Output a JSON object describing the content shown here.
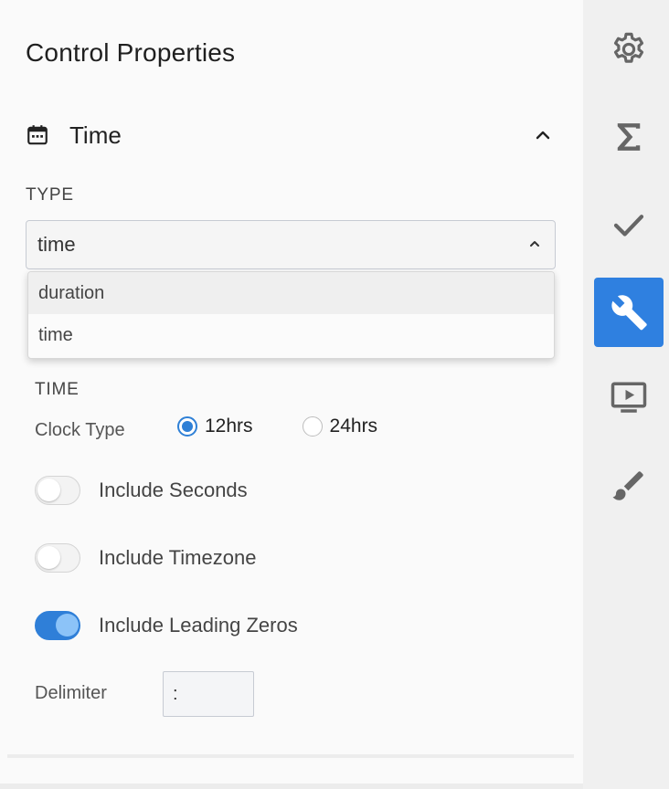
{
  "panel": {
    "title": "Control Properties",
    "section": {
      "title": "Time",
      "icon": "calendar-icon",
      "expanded": true
    },
    "type_field": {
      "label": "TYPE",
      "value": "time",
      "options": [
        "duration",
        "time"
      ],
      "open": true
    },
    "time_group": {
      "label": "TIME",
      "clock_type": {
        "label": "Clock Type",
        "options": [
          "12hrs",
          "24hrs"
        ],
        "selected": "12hrs"
      },
      "toggles": [
        {
          "label": "Include Seconds",
          "on": false
        },
        {
          "label": "Include Timezone",
          "on": false
        },
        {
          "label": "Include Leading Zeros",
          "on": true
        }
      ],
      "delimiter": {
        "label": "Delimiter",
        "value": ":"
      }
    }
  },
  "rail": {
    "items": [
      {
        "name": "settings",
        "icon": "gear-icon",
        "active": false
      },
      {
        "name": "calculations",
        "icon": "sigma-icon",
        "active": false
      },
      {
        "name": "validation",
        "icon": "checkmark-icon",
        "active": false
      },
      {
        "name": "properties",
        "icon": "wrench-icon",
        "active": true
      },
      {
        "name": "preview",
        "icon": "play-screen-icon",
        "active": false
      },
      {
        "name": "style",
        "icon": "paintbrush-icon",
        "active": false
      }
    ]
  },
  "colors": {
    "accent": "#2f80e0",
    "toggle_on": "#2f7fd8",
    "icon_gray": "#666666"
  }
}
